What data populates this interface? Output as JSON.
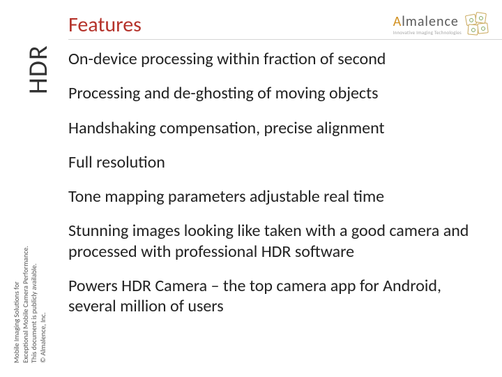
{
  "header": {
    "title": "Features",
    "logo": {
      "main_pre": "A",
      "main_rest": "lmalence",
      "tagline": "Innovative Imaging Technologies"
    }
  },
  "sideLabel": "HDR",
  "sideSmall": {
    "l1": "Mobile Imaging Solutions for",
    "l2": "Exceptional Mobile Camera Performance.",
    "l3": "This document is publicly available.",
    "l4": "© Almalence, Inc."
  },
  "bullets": [
    "On-device processing within fraction of second",
    "Processing and de-ghosting of moving objects",
    "Handshaking compensation, precise alignment",
    "Full resolution",
    "Tone mapping parameters adjustable real time",
    "Stunning images looking like taken with a good camera and processed with professional HDR software",
    "Powers HDR Camera – the top camera app for Android, several million of users"
  ]
}
